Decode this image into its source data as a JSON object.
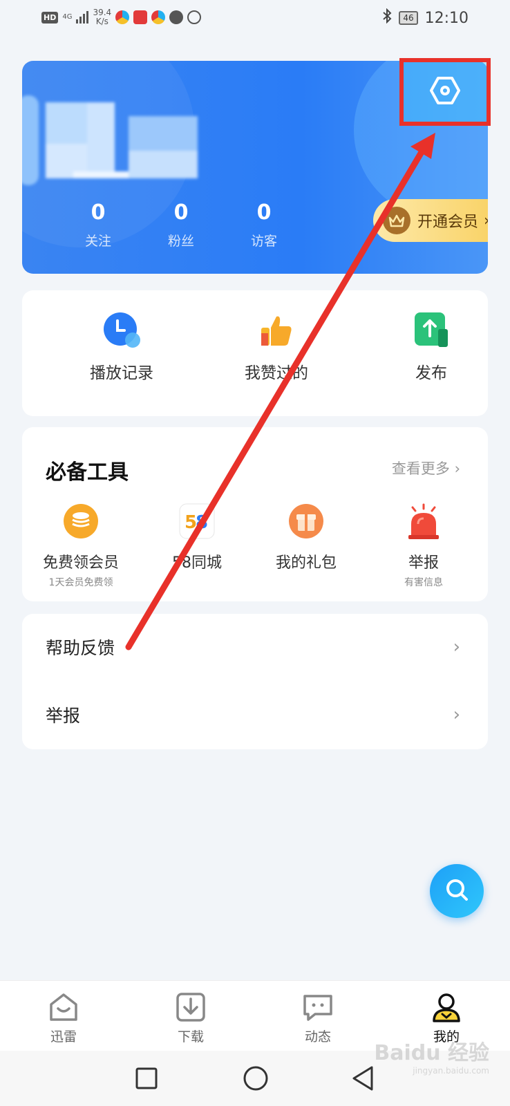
{
  "status_bar": {
    "hd": "HD",
    "network": "4G",
    "speed_value": "39.4",
    "speed_unit": "K/s",
    "battery": "46",
    "time": "12:10",
    "app_icon_colors": [
      "#22b0f0",
      "#e23a3a",
      "#2bb673",
      "#555555",
      "#555555"
    ]
  },
  "profile": {
    "settings_icon": "settings-hexagon-icon",
    "stats": [
      {
        "value": "0",
        "label": "关注"
      },
      {
        "value": "0",
        "label": "粉丝"
      },
      {
        "value": "0",
        "label": "访客"
      }
    ],
    "vip_label": "开通会员",
    "vip_arrow": "›"
  },
  "quick_actions": [
    {
      "label": "播放记录",
      "icon": "clock-icon",
      "color": "#2a7cf6"
    },
    {
      "label": "我赞过的",
      "icon": "thumbs-up-icon",
      "color": "#f7a92a"
    },
    {
      "label": "发布",
      "icon": "upload-icon",
      "color": "#2bc27a"
    }
  ],
  "tools": {
    "title": "必备工具",
    "more": "查看更多 ›",
    "items": [
      {
        "label": "免费领会员",
        "sub": "1天会员免费领",
        "icon": "coin-stack-icon"
      },
      {
        "label": "58同城",
        "sub": "",
        "icon": "58-logo-icon"
      },
      {
        "label": "我的礼包",
        "sub": "",
        "icon": "gift-icon"
      },
      {
        "label": "举报",
        "sub": "有害信息",
        "icon": "alarm-icon"
      }
    ]
  },
  "menu": [
    {
      "label": "帮助反馈",
      "chevron": "›"
    },
    {
      "label": "举报",
      "chevron": "›"
    }
  ],
  "tab_bar": [
    {
      "label": "迅雷",
      "icon": "home-icon",
      "active": false
    },
    {
      "label": "下载",
      "icon": "download-icon",
      "active": false
    },
    {
      "label": "动态",
      "icon": "chat-icon",
      "active": false
    },
    {
      "label": "我的",
      "icon": "profile-icon",
      "active": true
    }
  ],
  "watermark": {
    "brand": "Baidu 经验",
    "url": "jingyan.baidu.com"
  },
  "colors": {
    "accent": "#2a7cf6",
    "highlight": "#e8312a",
    "background": "#f2f5f9"
  }
}
